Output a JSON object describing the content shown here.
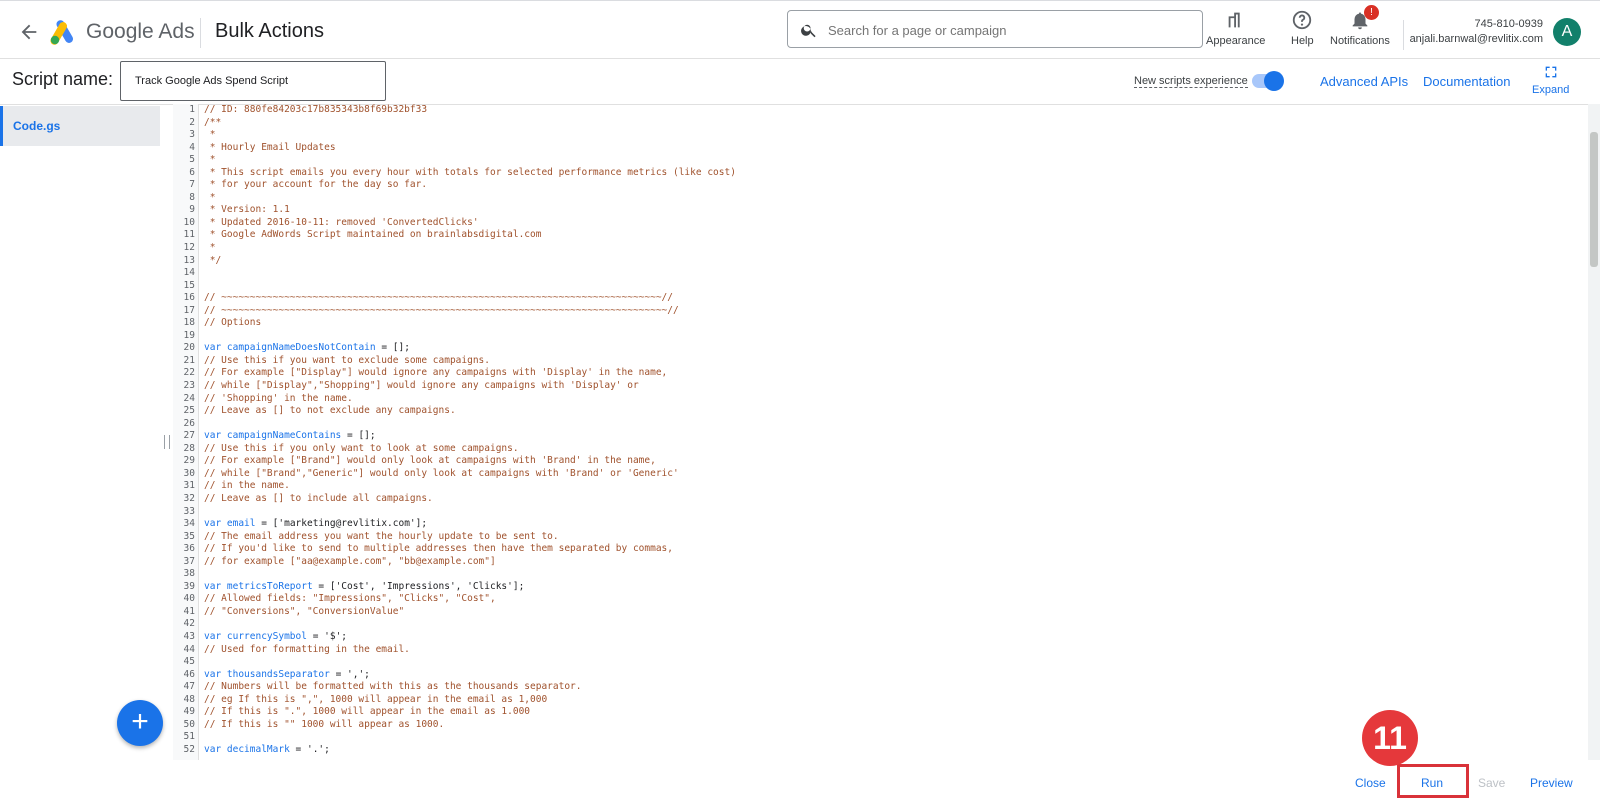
{
  "header": {
    "brand": "Google Ads",
    "section": "Bulk Actions",
    "search_placeholder": "Search for a page or campaign",
    "appearance_label": "Appearance",
    "help_label": "Help",
    "notifications_label": "Notifications",
    "notifications_count": "!",
    "account_phone": "745-810-0939",
    "account_email": "anjali.barnwal@revlitix.com",
    "avatar_letter": "A"
  },
  "scriptbar": {
    "label": "Script name:",
    "script_name": "Track Google Ads Spend Script",
    "new_experience": "New scripts experience",
    "new_experience_on": true,
    "advanced_apis": "Advanced APIs",
    "documentation": "Documentation",
    "expand": "Expand"
  },
  "sidebar": {
    "files": [
      "Code.gs"
    ],
    "add_icon": "plus-icon"
  },
  "editor": {
    "lines": [
      "// ID: 880fe84203c17b835343b8f69b32bf33",
      "/**",
      " *",
      " * Hourly Email Updates",
      " *",
      " * This script emails you every hour with totals for selected performance metrics (like cost)",
      " * for your account for the day so far.",
      " *",
      " * Version: 1.1",
      " * Updated 2016-10-11: removed 'ConvertedClicks'",
      " * Google AdWords Script maintained on brainlabsdigital.com",
      " *",
      " */",
      "",
      "",
      "// ~~~~~~~~~~~~~~~~~~~~~~~~~~~~~~~~~~~~~~~~~~~~~~~~~~~~~~~~~~~~~~~~~~~~~~~~~~~~~//",
      "// ~~~~~~~~~~~~~~~~~~~~~~~~~~~~~~~~~~~~~~~~~~~~~~~~~~~~~~~~~~~~~~~~~~~~~~~~~~~~~~//",
      "// Options",
      "",
      "var campaignNameDoesNotContain = [];",
      "// Use this if you want to exclude some campaigns.",
      "// For example [\"Display\"] would ignore any campaigns with 'Display' in the name,",
      "// while [\"Display\",\"Shopping\"] would ignore any campaigns with 'Display' or",
      "// 'Shopping' in the name.",
      "// Leave as [] to not exclude any campaigns.",
      "",
      "var campaignNameContains = [];",
      "// Use this if you only want to look at some campaigns.",
      "// For example [\"Brand\"] would only look at campaigns with 'Brand' in the name,",
      "// while [\"Brand\",\"Generic\"] would only look at campaigns with 'Brand' or 'Generic'",
      "// in the name.",
      "// Leave as [] to include all campaigns.",
      "",
      "var email = ['marketing@revlitix.com'];",
      "// The email address you want the hourly update to be sent to.",
      "// If you'd like to send to multiple addresses then have them separated by commas,",
      "// for example [\"aa@example.com\", \"bb@example.com\"]",
      "",
      "var metricsToReport = ['Cost', 'Impressions', 'Clicks'];",
      "// Allowed fields: \"Impressions\", \"Clicks\", \"Cost\",",
      "// \"Conversions\", \"ConversionValue\"",
      "",
      "var currencySymbol = '$';",
      "// Used for formatting in the email.",
      "",
      "var thousandsSeparator = ',';",
      "// Numbers will be formatted with this as the thousands separator.",
      "// eg If this is \",\", 1000 will appear in the email as 1,000",
      "// If this is \".\", 1000 will appear in the email as 1.000",
      "// If this is \"\" 1000 will appear as 1000.",
      "",
      "var decimalMark = '.';"
    ]
  },
  "footer": {
    "close": "Close",
    "run": "Run",
    "save": "Save",
    "preview": "Preview"
  },
  "annotation": {
    "step_number": "11"
  },
  "colors": {
    "accent": "#1a73e8",
    "highlight": "#d93239",
    "comment": "#a0522d",
    "variable": "#1a73e8"
  }
}
